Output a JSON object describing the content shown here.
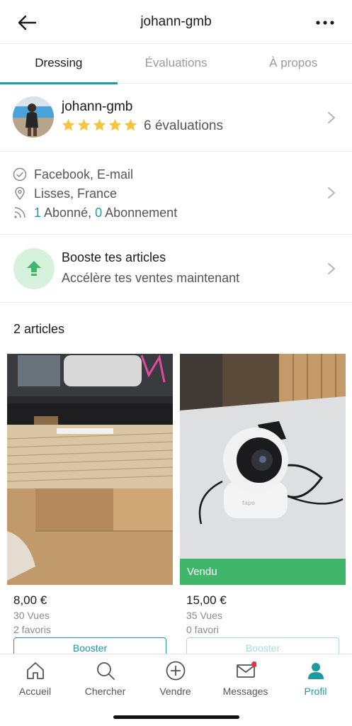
{
  "header": {
    "title": "johann-gmb",
    "back_icon": "arrow-left-icon",
    "more_icon": "more-dots-icon"
  },
  "tabs": [
    {
      "label": "Dressing",
      "active": true
    },
    {
      "label": "Évaluations",
      "active": false
    },
    {
      "label": "À propos",
      "active": false
    }
  ],
  "profile": {
    "username": "johann-gmb",
    "stars": 5,
    "rating_text": "6 évaluations"
  },
  "info": {
    "verified": "Facebook, E-mail",
    "location": "Lisses, France",
    "followers_count": "1",
    "followers_label": " Abonné, ",
    "following_count": "0",
    "following_label": " Abonnement"
  },
  "boost": {
    "title": "Booste tes articles",
    "subtitle": "Accélère tes ventes maintenant"
  },
  "articles_count": "2 articles",
  "items": [
    {
      "price": "8,00 €",
      "views": "30 Vues",
      "favorites": "2 favoris",
      "button": "Booster",
      "sold": false
    },
    {
      "price": "15,00 €",
      "views": "35 Vues",
      "favorites": "0 favori",
      "button": "Booster",
      "sold": true,
      "sold_label": "Vendu"
    }
  ],
  "nav": [
    {
      "label": "Accueil",
      "icon": "home-icon"
    },
    {
      "label": "Chercher",
      "icon": "search-icon"
    },
    {
      "label": "Vendre",
      "icon": "plus-circle-icon"
    },
    {
      "label": "Messages",
      "icon": "mail-icon"
    },
    {
      "label": "Profil",
      "icon": "profile-icon",
      "active": true
    }
  ],
  "colors": {
    "accent": "#1f9a9e",
    "star": "#f5c542",
    "sold": "#3fb66a",
    "boost_bg": "#d6f2dc"
  }
}
